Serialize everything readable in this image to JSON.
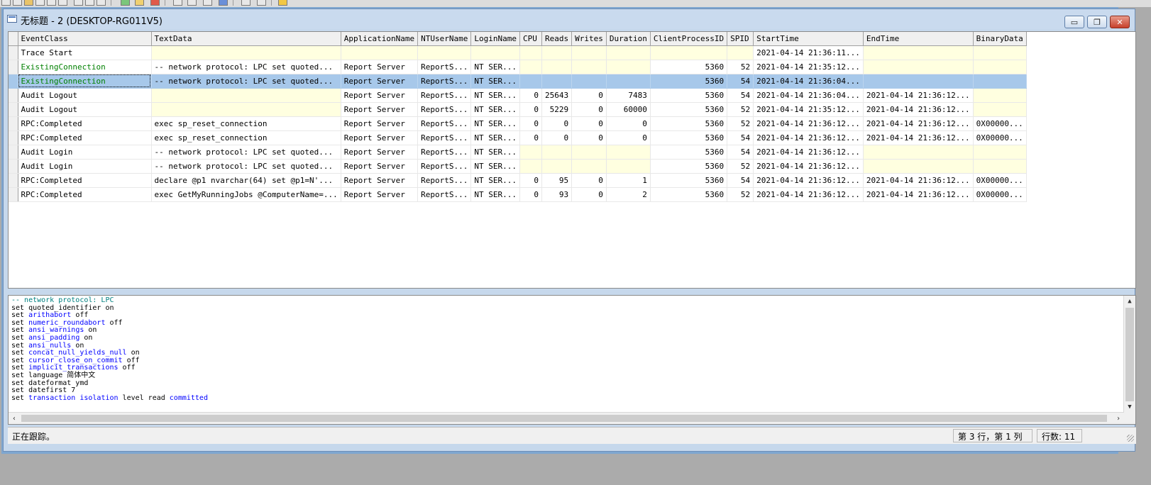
{
  "window": {
    "title": "无标题 - 2 (DESKTOP-RG011V5)",
    "minimize_label": "▭",
    "restore_label": "❐",
    "close_label": "✕"
  },
  "grid": {
    "columns": [
      "EventClass",
      "TextData",
      "ApplicationName",
      "NTUserName",
      "LoginName",
      "CPU",
      "Reads",
      "Writes",
      "Duration",
      "ClientProcessID",
      "SPID",
      "StartTime",
      "EndTime",
      "BinaryData"
    ],
    "selected_row": 2,
    "rows": [
      [
        "Trace Start",
        "",
        "",
        "",
        "",
        "",
        "",
        "",
        "",
        "",
        "",
        "2021-04-14 21:36:11...",
        "",
        ""
      ],
      [
        "ExistingConnection",
        "-- network protocol: LPC  set quoted...",
        "Report Server",
        "ReportS...",
        "NT SER...",
        "",
        "",
        "",
        "",
        "5360",
        "52",
        "2021-04-14 21:35:12...",
        "",
        ""
      ],
      [
        "ExistingConnection",
        "-- network protocol: LPC  set quoted...",
        "Report Server",
        "ReportS...",
        "NT SER...",
        "",
        "",
        "",
        "",
        "5360",
        "54",
        "2021-04-14 21:36:04...",
        "",
        ""
      ],
      [
        "Audit Logout",
        "",
        "Report Server",
        "ReportS...",
        "NT SER...",
        "0",
        "25643",
        "0",
        "7483",
        "5360",
        "54",
        "2021-04-14 21:36:04...",
        "2021-04-14 21:36:12...",
        ""
      ],
      [
        "Audit Logout",
        "",
        "Report Server",
        "ReportS...",
        "NT SER...",
        "0",
        "5229",
        "0",
        "60000",
        "5360",
        "52",
        "2021-04-14 21:35:12...",
        "2021-04-14 21:36:12...",
        ""
      ],
      [
        "RPC:Completed",
        "exec sp_reset_connection",
        "Report Server",
        "ReportS...",
        "NT SER...",
        "0",
        "0",
        "0",
        "0",
        "5360",
        "52",
        "2021-04-14 21:36:12...",
        "2021-04-14 21:36:12...",
        "0X00000..."
      ],
      [
        "RPC:Completed",
        "exec sp_reset_connection",
        "Report Server",
        "ReportS...",
        "NT SER...",
        "0",
        "0",
        "0",
        "0",
        "5360",
        "54",
        "2021-04-14 21:36:12...",
        "2021-04-14 21:36:12...",
        "0X00000..."
      ],
      [
        "Audit Login",
        "-- network protocol: LPC  set quoted...",
        "Report Server",
        "ReportS...",
        "NT SER...",
        "",
        "",
        "",
        "",
        "5360",
        "54",
        "2021-04-14 21:36:12...",
        "",
        ""
      ],
      [
        "Audit Login",
        "-- network protocol: LPC  set quoted...",
        "Report Server",
        "ReportS...",
        "NT SER...",
        "",
        "",
        "",
        "",
        "5360",
        "52",
        "2021-04-14 21:36:12...",
        "",
        ""
      ],
      [
        "RPC:Completed",
        "declare @p1 nvarchar(64)  set @p1=N'...",
        "Report Server",
        "ReportS...",
        "NT SER...",
        "0",
        "95",
        "0",
        "1",
        "5360",
        "54",
        "2021-04-14 21:36:12...",
        "2021-04-14 21:36:12...",
        "0X00000..."
      ],
      [
        "RPC:Completed",
        "exec GetMyRunningJobs @ComputerName=...",
        "Report Server",
        "ReportS...",
        "NT SER...",
        "0",
        "93",
        "0",
        "2",
        "5360",
        "52",
        "2021-04-14 21:36:12...",
        "2021-04-14 21:36:12...",
        "0X00000..."
      ]
    ]
  },
  "text_panel": {
    "lines": [
      [
        {
          "t": "-- network protocol: LPC",
          "c": "cmt"
        }
      ],
      [
        {
          "t": "set quoted_identifier on",
          "c": ""
        }
      ],
      [
        {
          "t": "set ",
          "c": ""
        },
        {
          "t": "arithabort",
          "c": "kw"
        },
        {
          "t": " off",
          "c": ""
        }
      ],
      [
        {
          "t": "set ",
          "c": ""
        },
        {
          "t": "numeric_roundabort",
          "c": "kw"
        },
        {
          "t": " off",
          "c": ""
        }
      ],
      [
        {
          "t": "set ",
          "c": ""
        },
        {
          "t": "ansi_warnings",
          "c": "kw"
        },
        {
          "t": " on",
          "c": ""
        }
      ],
      [
        {
          "t": "set ",
          "c": ""
        },
        {
          "t": "ansi_padding",
          "c": "kw"
        },
        {
          "t": " on",
          "c": ""
        }
      ],
      [
        {
          "t": "set ",
          "c": ""
        },
        {
          "t": "ansi_nulls",
          "c": "kw"
        },
        {
          "t": " on",
          "c": ""
        }
      ],
      [
        {
          "t": "set ",
          "c": ""
        },
        {
          "t": "concat_null_yields_null",
          "c": "kw"
        },
        {
          "t": " on",
          "c": ""
        }
      ],
      [
        {
          "t": "set ",
          "c": ""
        },
        {
          "t": "cursor_close_on_commit",
          "c": "kw"
        },
        {
          "t": " off",
          "c": ""
        }
      ],
      [
        {
          "t": "set ",
          "c": ""
        },
        {
          "t": "implicit_transactions",
          "c": "kw"
        },
        {
          "t": " off",
          "c": ""
        }
      ],
      [
        {
          "t": "set language 简体中文",
          "c": ""
        }
      ],
      [
        {
          "t": "set dateformat ymd",
          "c": ""
        }
      ],
      [
        {
          "t": "set datefirst 7",
          "c": ""
        }
      ],
      [
        {
          "t": "set ",
          "c": ""
        },
        {
          "t": "transaction isolation",
          "c": "kw"
        },
        {
          "t": " level read ",
          "c": ""
        },
        {
          "t": "committed",
          "c": "kw"
        }
      ]
    ]
  },
  "status": {
    "text": "正在跟踪。",
    "position": "第 3 行，第 1 列",
    "row_count": "行数: 11"
  },
  "colors": {
    "null_cell": "#ffffe0",
    "selection": "#a7c8ea",
    "existing_connection_text": "#008000"
  }
}
